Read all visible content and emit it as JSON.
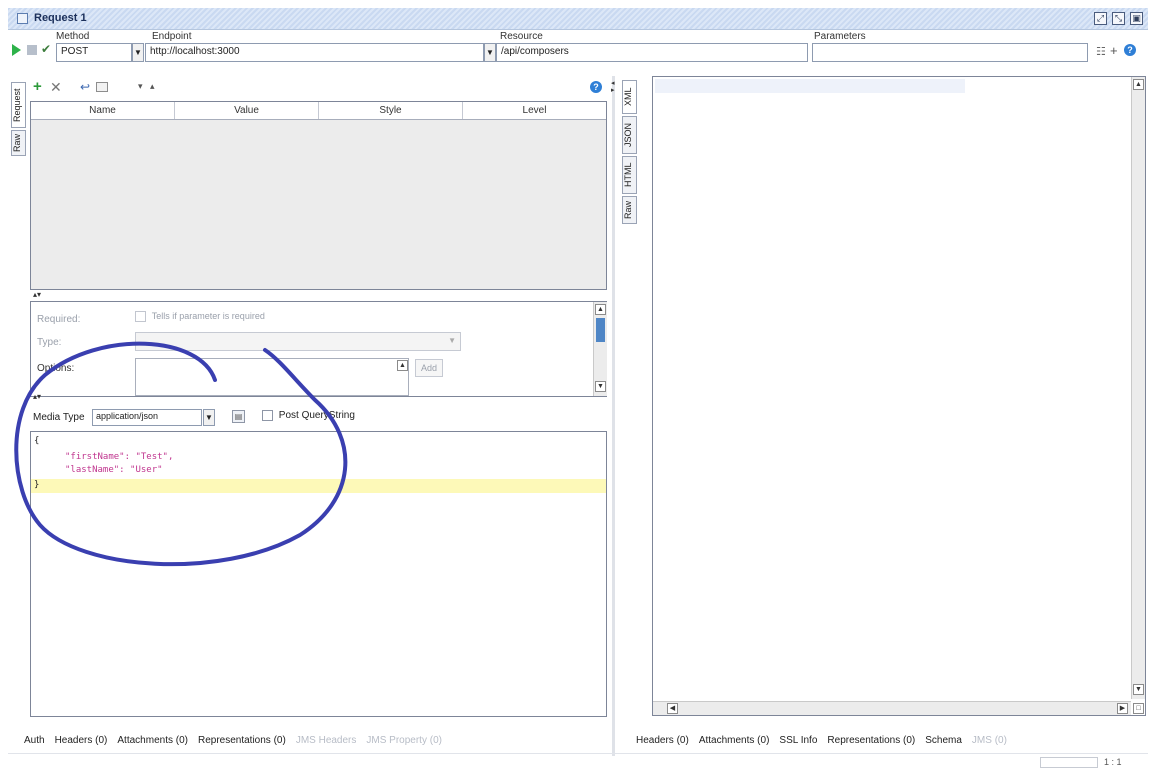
{
  "window": {
    "title": "Request 1"
  },
  "toolbar": {
    "method_label": "Method",
    "method_value": "POST",
    "endpoint_label": "Endpoint",
    "endpoint_value": "http://localhost:3000",
    "resource_label": "Resource",
    "resource_value": "/api/composers",
    "parameters_label": "Parameters",
    "parameters_value": ""
  },
  "request_panel": {
    "side_tabs": [
      "Request",
      "Raw"
    ],
    "grid_columns": [
      "Name",
      "Value",
      "Style",
      "Level"
    ],
    "details": {
      "required_label": "Required:",
      "required_hint": "Tells if parameter is required",
      "type_label": "Type:",
      "options_label": "Options:",
      "add_button": "Add"
    },
    "media_type_label": "Media Type",
    "media_type_value": "application/json",
    "post_query_label": "Post QueryString",
    "body_lines": [
      "{",
      "\"firstName\": \"Test\",",
      "\"lastName\": \"User\"",
      "}"
    ]
  },
  "response_panel": {
    "side_tabs": [
      "XML",
      "JSON",
      "HTML",
      "Raw"
    ],
    "position": "1 : 1"
  },
  "request_bottom_tabs": [
    {
      "label": "Auth",
      "enabled": true
    },
    {
      "label": "Headers (0)",
      "enabled": true
    },
    {
      "label": "Attachments (0)",
      "enabled": true
    },
    {
      "label": "Representations (0)",
      "enabled": true
    },
    {
      "label": "JMS Headers",
      "enabled": false
    },
    {
      "label": "JMS Property (0)",
      "enabled": false
    }
  ],
  "response_bottom_tabs": [
    {
      "label": "Headers (0)",
      "enabled": true
    },
    {
      "label": "Attachments (0)",
      "enabled": true
    },
    {
      "label": "SSL Info",
      "enabled": true
    },
    {
      "label": "Representations (0)",
      "enabled": true
    },
    {
      "label": "Schema",
      "enabled": true
    },
    {
      "label": "JMS (0)",
      "enabled": false
    }
  ],
  "annotation": {
    "color": "#3a3fb0",
    "shape": "hand-drawn circle"
  },
  "colors": {
    "accent": "#2db24a",
    "highlight_line": "#fdf9b8",
    "help": "#2f7fd6"
  }
}
